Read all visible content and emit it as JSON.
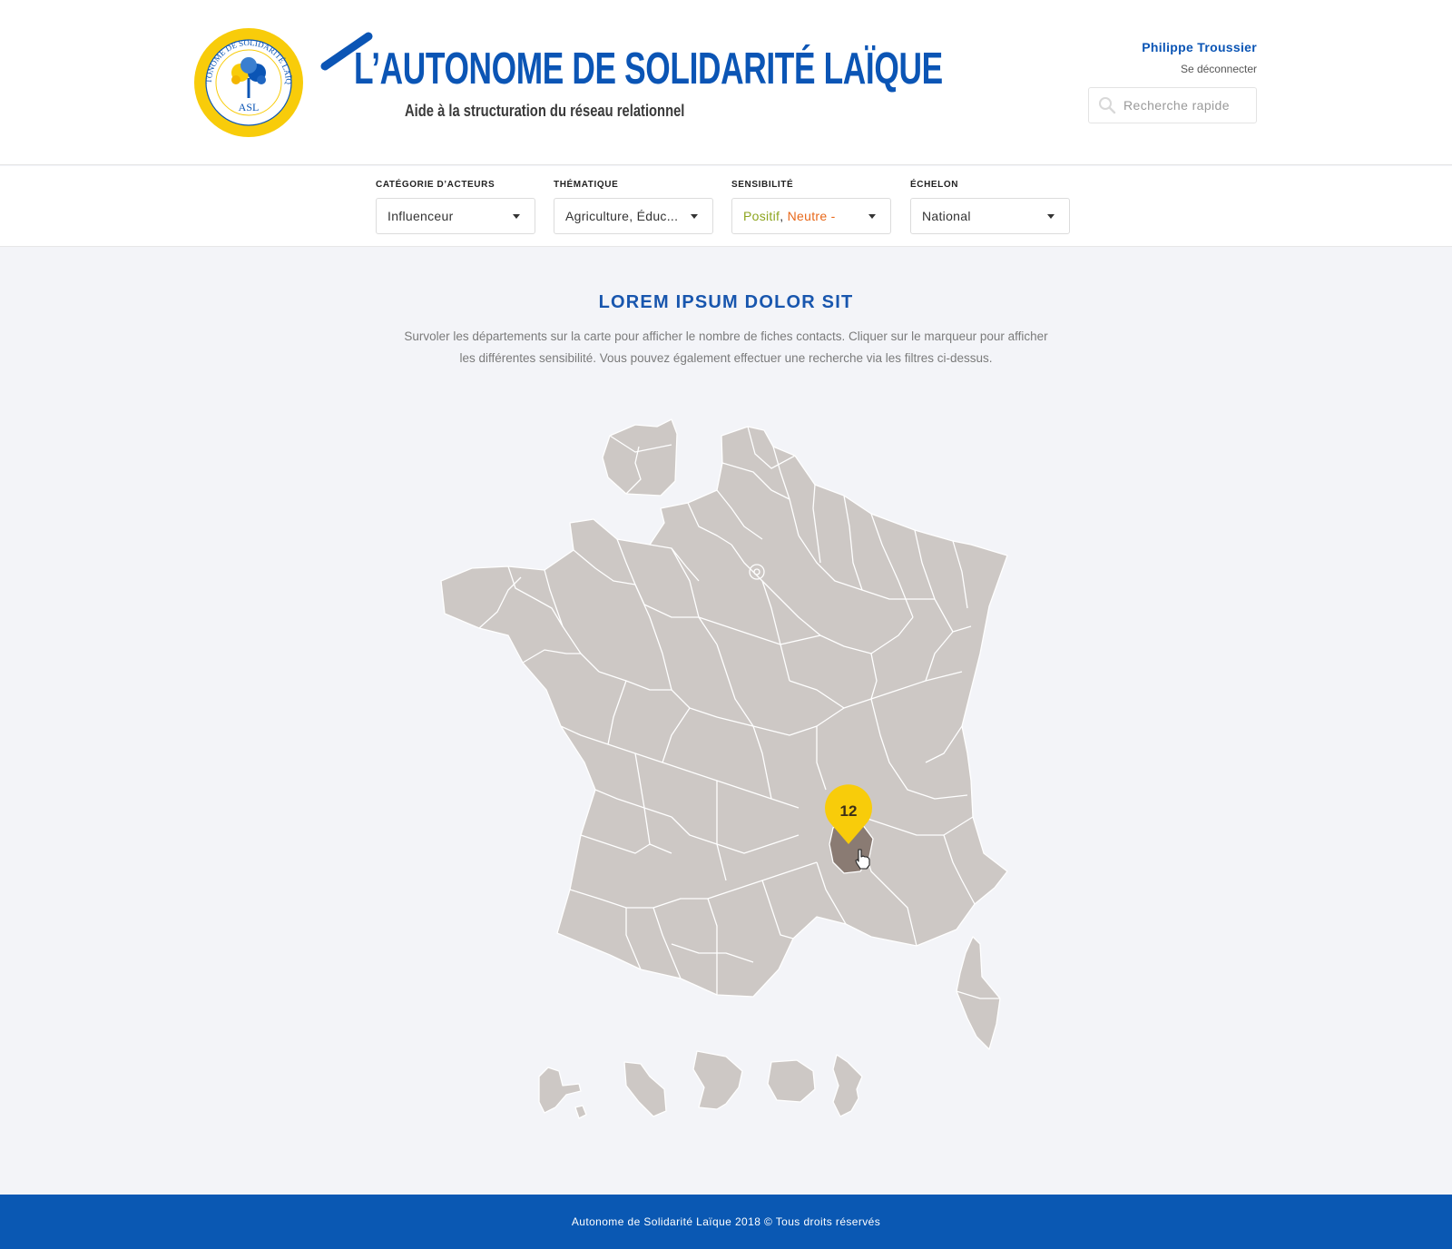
{
  "brand": {
    "title": "L’AUTONOME DE SOLIDARITÉ LAÏQUE",
    "subtitle": "Aide à la structuration du réseau relationnel",
    "seal_text": "AUTONOME DE SOLIDARITÉ LAÏQUE",
    "seal_initials": "ASL",
    "colors": {
      "blue": "#0b55b5",
      "yellow": "#f8cc0a"
    }
  },
  "user": {
    "name": "Philippe Troussier",
    "logout": "Se déconnecter"
  },
  "search": {
    "placeholder": "Recherche rapide"
  },
  "filters": {
    "categorie": {
      "label": "CATÉGORIE D’ACTEURS",
      "value": "Influenceur"
    },
    "thematique": {
      "label": "THÉMATIQUE",
      "value": "Agriculture, Éduc..."
    },
    "sensibilite": {
      "label": "SENSIBILITÉ",
      "value_positive": "Positif",
      "separator": ", ",
      "value_neutral": "Neutre -"
    },
    "echelon": {
      "label": "ÉCHELON",
      "value": "National"
    }
  },
  "content": {
    "title": "LOREM IPSUM DOLOR SIT",
    "intro": "Survoler les départements sur la carte pour afficher le nombre de fiches contacts. Cliquer sur le marqueur pour afficher les différentes sensibilité. Vous pouvez également effectuer une recherche via les filtres ci-dessus."
  },
  "map": {
    "marker_count": "12",
    "colors": {
      "land": "#cdc8c5",
      "border": "#ffffff",
      "highlight": "#8a7b73",
      "marker": "#f8cc0a"
    }
  },
  "footer": {
    "text": "Autonome de Solidarité Laïque 2018 © Tous droits réservés",
    "color": "#0a58b3"
  }
}
